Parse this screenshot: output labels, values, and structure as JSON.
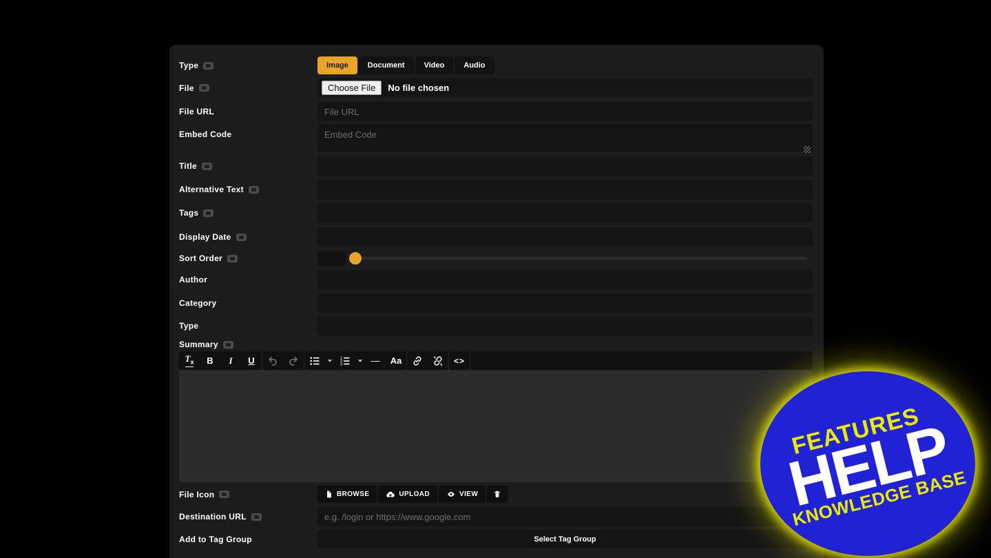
{
  "colors": {
    "accent_yellow": "#e9a52a",
    "badge_blue": "#2121d6",
    "badge_yellow": "#e9ec00",
    "panel_bg": "#1c1c1c"
  },
  "form": {
    "type": {
      "label": "Type",
      "active_tab": "Image",
      "tabs": [
        "Image",
        "Document",
        "Video",
        "Audio"
      ]
    },
    "file": {
      "label": "File",
      "choose_button": "Choose File",
      "status": "No file chosen"
    },
    "file_url": {
      "label": "File URL",
      "placeholder": "File URL",
      "value": ""
    },
    "embed_code": {
      "label": "Embed Code",
      "placeholder": "Embed Code",
      "value": ""
    },
    "title": {
      "label": "Title",
      "value": ""
    },
    "alternative_text": {
      "label": "Alternative Text",
      "value": ""
    },
    "tags": {
      "label": "Tags",
      "value": ""
    },
    "display_date": {
      "label": "Display Date",
      "value": ""
    },
    "sort_order": {
      "label": "Sort Order",
      "value": ""
    },
    "author": {
      "label": "Author",
      "value": ""
    },
    "category": {
      "label": "Category",
      "value": ""
    },
    "type2": {
      "label": "Type",
      "value": ""
    },
    "summary": {
      "label": "Summary",
      "toolbar": {
        "clear_t": "T",
        "clear_x": "x",
        "bold": "B",
        "italic": "I",
        "underline": "U",
        "hr": "—",
        "font_size": "Aa",
        "code": "<>"
      }
    },
    "file_icon": {
      "label": "File Icon",
      "browse": "BROWSE",
      "upload": "UPLOAD",
      "view": "VIEW"
    },
    "destination_url": {
      "label": "Destination URL",
      "placeholder": "e.g. /login or https://www.google.com",
      "value": ""
    },
    "tag_group": {
      "label": "Add to Tag Group",
      "button": "Select Tag Group"
    }
  },
  "badge": {
    "top": "FEATURES",
    "middle": "HELP",
    "bottom": "KNOWLEDGE BASE"
  }
}
